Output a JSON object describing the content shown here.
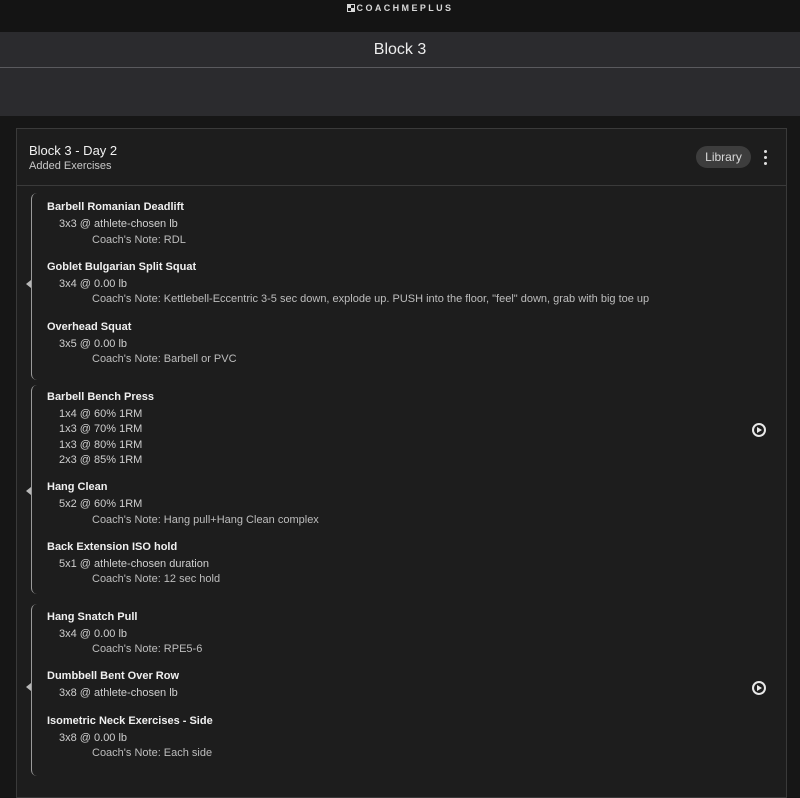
{
  "header": {
    "brand": "COACHMEPLUS",
    "page_title": "Block 3"
  },
  "card": {
    "title": "Block 3 - Day 2",
    "subtitle": "Added Exercises",
    "library_label": "Library"
  },
  "groups": [
    {
      "exercises": [
        {
          "name": "Barbell Romanian Deadlift",
          "sets": [
            "3x3 @ athlete-chosen lb"
          ],
          "note": "Coach's Note: RDL"
        },
        {
          "name": "Goblet Bulgarian Split Squat",
          "sets": [
            "3x4 @ 0.00 lb"
          ],
          "note": "Coach's Note: Kettlebell-Eccentric 3-5 sec down, explode up. PUSH into the floor, \"feel\" down, grab with big toe up"
        },
        {
          "name": "Overhead Squat",
          "sets": [
            "3x5 @ 0.00 lb"
          ],
          "note": "Coach's Note: Barbell or PVC"
        }
      ]
    },
    {
      "exercises": [
        {
          "name": "Barbell Bench Press",
          "sets": [
            "1x4 @ 60% 1RM",
            "1x3 @ 70% 1RM",
            "1x3 @ 80% 1RM",
            "2x3 @ 85% 1RM"
          ]
        },
        {
          "name": "Hang Clean",
          "sets": [
            "5x2 @ 60% 1RM"
          ],
          "note": "Coach's Note: Hang pull+Hang Clean complex"
        },
        {
          "name": "Back Extension ISO hold",
          "sets": [
            "5x1 @ athlete-chosen duration"
          ],
          "note": "Coach's Note: 12 sec hold"
        }
      ]
    },
    {
      "exercises": [
        {
          "name": "Hang Snatch Pull",
          "sets": [
            "3x4 @ 0.00 lb"
          ],
          "note": "Coach's Note: RPE5-6"
        },
        {
          "name": "Dumbbell Bent Over Row",
          "sets": [
            "3x8 @ athlete-chosen lb"
          ]
        },
        {
          "name": "Isometric Neck Exercises - Side",
          "sets": [
            "3x8 @ 0.00 lb"
          ],
          "note": "Coach's Note: Each side"
        }
      ]
    }
  ]
}
